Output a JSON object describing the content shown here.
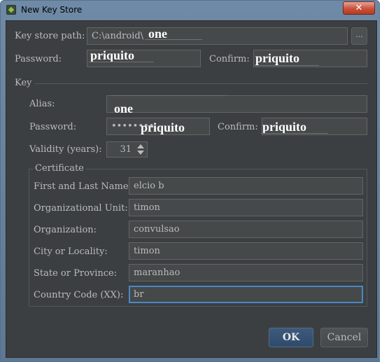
{
  "window": {
    "title": "New Key Store",
    "close_label": "✕"
  },
  "keystore": {
    "path_label": "Key store path:",
    "path_value": "C:\\android\\",
    "path_overlay": "one",
    "browse_label": "...",
    "password_label": "Password:",
    "password_overlay": "priquito",
    "confirm_label": "Confirm:",
    "confirm_overlay": "priquito"
  },
  "key": {
    "section_label": "Key",
    "alias_label": "Alias:",
    "alias_overlay": "one",
    "password_label": "Password:",
    "password_dots": "••••••••",
    "password_overlay": "priquito",
    "confirm_label": "Confirm:",
    "confirm_overlay": "priquito",
    "validity_label": "Validity (years):",
    "validity_value": "31"
  },
  "certificate": {
    "group_label": "Certificate",
    "first_last_label": "First and Last Name:",
    "first_last_value": "elcio b",
    "org_unit_label": "Organizational Unit:",
    "org_unit_value": "timon",
    "org_label": "Organization:",
    "org_value": "convulsao",
    "city_label": "City or Locality:",
    "city_value": "timon",
    "state_label": "State or Province:",
    "state_value": "maranhao",
    "country_label": "Country Code (XX):",
    "country_value": "br"
  },
  "buttons": {
    "ok_label": "OK",
    "cancel_label": "Cancel"
  }
}
